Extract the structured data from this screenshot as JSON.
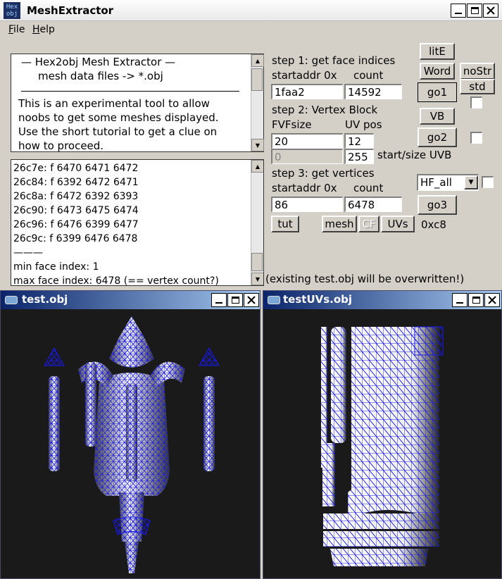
{
  "app": {
    "title": "MeshExtractor",
    "icon_text": "Hex obj"
  },
  "menu": [
    "File",
    "Help"
  ],
  "caption_buttons": {
    "minimize": "_",
    "maximize": "□",
    "close": "✕"
  },
  "info": {
    "header1": "—   Hex2obj Mesh Extractor   —",
    "header2": "mesh data files -> *.obj",
    "body": [
      "This is an experimental tool to allow",
      "noobs to get some meshes displayed.",
      "Use the short tutorial to get a clue on",
      "how to proceed."
    ]
  },
  "log": {
    "lines": [
      "26c7e: f  6470 6471 6472",
      "26c84: f  6392 6472 6471",
      "26c8a: f  6472 6392 6393",
      "26c90: f  6473 6475 6474",
      "26c96: f  6476 6399 6477",
      "26c9c: f  6399 6476 6478"
    ],
    "separator": "———",
    "min": "min face index: 1",
    "max": "max face index: 6478 (== vertex count?)"
  },
  "step1": {
    "title": "step 1: get face indices",
    "startaddr_label": "startaddr 0x",
    "count_label": "count",
    "startaddr": "1faa2",
    "count": "14592"
  },
  "step2": {
    "title": "step 2: Vertex Block",
    "fvf_label": "FVFsize",
    "uv_label": "UV pos",
    "fvf": "20",
    "uv": "12",
    "start_uvb": "0",
    "size_uvb": "255",
    "uvb_label": "start/size UVB"
  },
  "step3": {
    "title": "step 3: get vertices",
    "startaddr_label": "startaddr 0x",
    "count_label": "count",
    "startaddr": "86",
    "count": "6478",
    "preset": "HF_all"
  },
  "buttons": {
    "lite": "litE",
    "word": "Word",
    "nostr": "noStr",
    "std": "std",
    "go1": "go1",
    "vb": "VB",
    "go2": "go2",
    "go3": "go3",
    "tut": "tut",
    "mesh": "mesh",
    "cf": "CF",
    "uvs": "UVs",
    "hex": "0xc8"
  },
  "warning": "(existing test.obj will be overwritten!)",
  "windows": [
    {
      "title": "test.obj"
    },
    {
      "title": "testUVs.obj"
    }
  ],
  "colors": {
    "wire": "#1010e0",
    "viewport_bg": "#1a1a1a",
    "titlebar_active": "#0a246a"
  }
}
